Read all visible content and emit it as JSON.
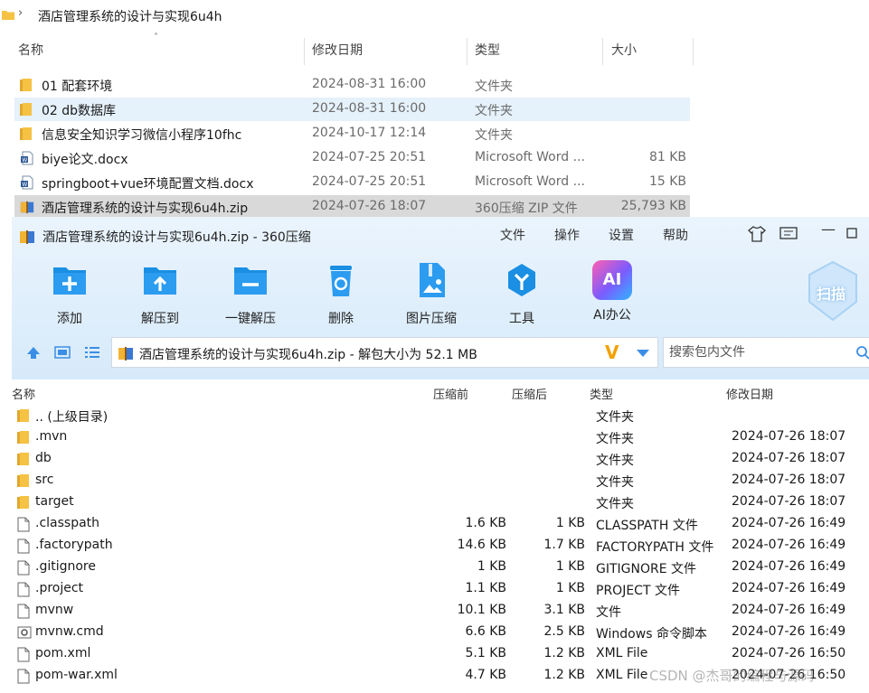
{
  "explorer": {
    "breadcrumb": "酒店管理系统的设计与实现6u4h",
    "headers": {
      "name": "名称",
      "date": "修改日期",
      "type": "类型",
      "size": "大小"
    },
    "files": [
      {
        "name": "01 配套环境",
        "date": "2024-08-31 16:00",
        "type": "文件夹",
        "size": "",
        "icon": "folder-icon"
      },
      {
        "name": "02 db数据库",
        "date": "2024-08-31 16:00",
        "type": "文件夹",
        "size": "",
        "icon": "folder-icon"
      },
      {
        "name": "信息安全知识学习微信小程序10fhc",
        "date": "2024-10-17 12:14",
        "type": "文件夹",
        "size": "",
        "icon": "folder-icon"
      },
      {
        "name": "biye论文.docx",
        "date": "2024-07-25 20:51",
        "type": "Microsoft Word ...",
        "size": "81 KB",
        "icon": "word-doc-icon"
      },
      {
        "name": "springboot+vue环境配置文档.docx",
        "date": "2024-07-25 20:51",
        "type": "Microsoft Word ...",
        "size": "15 KB",
        "icon": "word-doc-icon"
      },
      {
        "name": "酒店管理系统的设计与实现6u4h.zip",
        "date": "2024-07-26 18:07",
        "type": "360压缩 ZIP 文件",
        "size": "25,793 KB",
        "icon": "zip-archive-icon"
      }
    ]
  },
  "archiver": {
    "title": "酒店管理系统的设计与实现6u4h.zip - 360压缩",
    "menu": [
      "文件",
      "操作",
      "设置",
      "帮助"
    ],
    "toolbar": [
      {
        "label": "添加",
        "icon": "add-icon"
      },
      {
        "label": "解压到",
        "icon": "extract-to-icon"
      },
      {
        "label": "一键解压",
        "icon": "one-click-extract-icon"
      },
      {
        "label": "删除",
        "icon": "delete-icon"
      },
      {
        "label": "图片压缩",
        "icon": "image-compress-icon"
      },
      {
        "label": "工具",
        "icon": "tools-icon"
      },
      {
        "label": "AI办公",
        "icon": "ai-office-icon"
      }
    ],
    "scan_label": "扫描",
    "ai_badge": "AI",
    "address": "酒店管理系统的设计与实现6u4h.zip - 解包大小为 52.1 MB",
    "address_badge": "V",
    "search_placeholder": "搜索包内文件",
    "columns": {
      "name": "名称",
      "compressed": "压缩前",
      "uncompressed": "压缩后",
      "type": "类型",
      "modified": "修改日期"
    },
    "rows": [
      {
        "name": ".. (上级目录)",
        "before": "",
        "after": "",
        "type": "文件夹",
        "modified": "",
        "icon": "folder-icon"
      },
      {
        "name": ".mvn",
        "before": "",
        "after": "",
        "type": "文件夹",
        "modified": "2024-07-26 18:07",
        "icon": "folder-icon"
      },
      {
        "name": "db",
        "before": "",
        "after": "",
        "type": "文件夹",
        "modified": "2024-07-26 18:07",
        "icon": "folder-icon"
      },
      {
        "name": "src",
        "before": "",
        "after": "",
        "type": "文件夹",
        "modified": "2024-07-26 18:07",
        "icon": "folder-icon"
      },
      {
        "name": "target",
        "before": "",
        "after": "",
        "type": "文件夹",
        "modified": "2024-07-26 18:07",
        "icon": "folder-icon"
      },
      {
        "name": ".classpath",
        "before": "1.6 KB",
        "after": "1 KB",
        "type": "CLASSPATH 文件",
        "modified": "2024-07-26 16:49",
        "icon": "file-icon"
      },
      {
        "name": ".factorypath",
        "before": "14.6 KB",
        "after": "1.7 KB",
        "type": "FACTORYPATH 文件",
        "modified": "2024-07-26 16:49",
        "icon": "file-icon"
      },
      {
        "name": ".gitignore",
        "before": "1 KB",
        "after": "1 KB",
        "type": "GITIGNORE 文件",
        "modified": "2024-07-26 16:49",
        "icon": "file-icon"
      },
      {
        "name": ".project",
        "before": "1.1 KB",
        "after": "1 KB",
        "type": "PROJECT 文件",
        "modified": "2024-07-26 16:49",
        "icon": "file-icon"
      },
      {
        "name": "mvnw",
        "before": "10.1 KB",
        "after": "3.1 KB",
        "type": "文件",
        "modified": "2024-07-26 16:49",
        "icon": "file-icon"
      },
      {
        "name": "mvnw.cmd",
        "before": "6.6 KB",
        "after": "2.5 KB",
        "type": "Windows 命令脚本",
        "modified": "2024-07-26 16:49",
        "icon": "cmd-script-icon"
      },
      {
        "name": "pom.xml",
        "before": "5.1 KB",
        "after": "1.2 KB",
        "type": "XML File",
        "modified": "2024-07-26 16:50",
        "icon": "file-icon"
      },
      {
        "name": "pom-war.xml",
        "before": "4.7 KB",
        "after": "1.2 KB",
        "type": "XML File",
        "modified": "2024-07-26 16:50",
        "icon": "file-icon"
      }
    ]
  },
  "watermark": "CSDN @杰哥的编程与源码",
  "colors": {
    "accent": "#1a8fe3",
    "folder": "#f5c243",
    "ribbon": "#d7eafa",
    "selection": "#e5f1fb"
  }
}
